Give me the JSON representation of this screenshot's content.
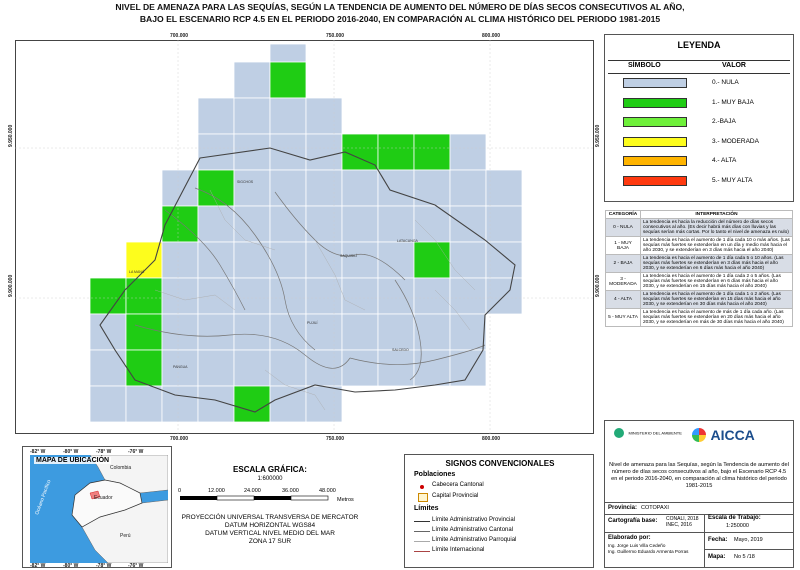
{
  "title": {
    "line1": "NIVEL DE AMENAZA PARA LAS SEQUÍAS, SEGÚN LA TENDENCIA DE AUMENTO DEL NÚMERO DE DÍAS SECOS CONSECUTIVOS AL AÑO,",
    "line2": "BAJO EL ESCENARIO RCP 4.5 EN EL PERIODO 2016-2040, EN COMPARACIÓN AL CLIMA HISTÓRICO DEL PERIODO 1981-2015"
  },
  "map": {
    "x_ticks_top": [
      "700.000",
      "750.000",
      "800.000"
    ],
    "x_ticks_bottom": [
      "700.000",
      "750.000",
      "800.000"
    ],
    "y_ticks_left": [
      "9.950.000",
      "9.900.000"
    ],
    "y_ticks_right": [
      "9.950.000",
      "9.900.000"
    ],
    "place_labels": [
      "SIGCHOS",
      "SAQUISILÍ",
      "LATACUNGA",
      "PUJILÍ",
      "SALCEDO",
      "PANGUA",
      "LA MANÁ",
      "PUJILÍ"
    ],
    "colors": {
      "nula": "#bfcfe4",
      "muy_baja": "#1fcc14",
      "baja": "#6ef03a",
      "moderada": "#fdfd1d",
      "alta": "#ffb400",
      "muy_alta": "#ff3a10"
    }
  },
  "legend": {
    "title": "LEYENDA",
    "col_symbol": "SÍMBOLO",
    "col_value": "VALOR",
    "items": [
      {
        "label": "0.- NULA",
        "color": "#bfcfe4"
      },
      {
        "label": "1.- MUY BAJA",
        "color": "#1fcc14"
      },
      {
        "label": "2.-BAJA",
        "color": "#6ef03a"
      },
      {
        "label": "3.- MODERADA",
        "color": "#fdfd1d"
      },
      {
        "label": "4.- ALTA",
        "color": "#ffb400"
      },
      {
        "label": "5.- MUY ALTA",
        "color": "#ff3a10"
      }
    ]
  },
  "interpretation": {
    "col_cat": "CATEGORÍA",
    "col_interp": "INTERPRETACIÓN",
    "rows": [
      {
        "cat": "0 - NULA",
        "text": "La tendencia es hacia la reducción del número de días secos consecutivos al año. (Es decir habrá más días con lluvias y las sequías serían más cortas. Por lo tanto el nivel de amenaza es nulo)"
      },
      {
        "cat": "1 - MUY BAJA",
        "text": "La tendencia es hacia el aumento de 1 día cada 10 o más años. (Las sequías más fuertes se extenderían en un día y medio más hacia el año 2030, y se extenderían en 3 días más hacia el año 2040)"
      },
      {
        "cat": "2 - BAJA",
        "text": "La tendencia es hacia el aumento de 1 día cada 5 o 10 años. (Las sequías más fuertes se extenderían en 3 días más hacia el año 2030, y se extenderían en 6 días más hacia el año 2040)"
      },
      {
        "cat": "3 - MODERADA",
        "text": "La tendencia es hacia el aumento de 1 día cada 2 o 5 años. (Las sequías más fuertes se extenderían en 6 días más hacia el año 2030, y se extenderían en 15 días más hacia el año 2040)"
      },
      {
        "cat": "4 - ALTA",
        "text": "La tendencia es hacia el aumento de 1 día cada 1 o 2 años. (Las sequías más fuertes se extenderían en 15 días más hacia el año 2030, y se extenderían en 30 días más hacia el año 2040)"
      },
      {
        "cat": "5 - MUY ALTA",
        "text": "La tendencia es hacia el aumento de más de 1 día cada año. (Las sequías más fuertes se extenderían en 20 días más hacia el año 2030, y se extenderían en más de 30 días más hacia el año 2040)"
      }
    ]
  },
  "location_map": {
    "title": "MAPA DE UBICACIÓN",
    "labels": {
      "colombia": "Colombia",
      "ecuador": "Ecuador",
      "peru": "Perú",
      "ocean": "Océano Pacífico"
    },
    "lon_ticks": [
      "-82° W",
      "-80° W",
      "-78° W",
      "-76° W"
    ]
  },
  "scale": {
    "title": "ESCALA GRÁFICA:",
    "ratio": "1:600000",
    "ticks": [
      "0",
      "12.000",
      "24.000",
      "36.000",
      "48.000"
    ],
    "unit": "Metros",
    "projection": [
      "PROYECCIÓN UNIVERSAL TRANSVERSA DE MERCATOR",
      "DATUM HORIZONTAL WGS84",
      "DATUM VERTICAL NIVEL MEDIO DEL MAR",
      "ZONA 17 SUR"
    ]
  },
  "signs": {
    "title": "SIGNOS CONVENCIONALES",
    "poblaciones": "Poblaciones",
    "cabecera_cantonal": "Cabecera Cantonal",
    "capital_provincial": "Capital Provincial",
    "limites": "Límites",
    "lim_provincial": "Límite Administrativo Provincial",
    "lim_cantonal": "Límite Administrativo Cantonal",
    "lim_parroquial": "Límite Administrativo Parroquial",
    "lim_internacional": "Límite Internacional"
  },
  "info": {
    "logo_ministry": "MINISTERIO DEL AMBIENTE",
    "logo_aicca": "AICCA",
    "description": "Nivel de amenaza para las Sequías, según la Tendencia de aumento del número de días secos consecutivos al año, bajo el Escenario RCP 4.5 en el periodo 2016-2040, en comparación al clima histórico del periodo 1981-2015",
    "provincia_label": "Provincia:",
    "provincia": "COTOPAXI",
    "cartografia_label": "Cartografía base:",
    "cartografia": "CONALI, 2018\nINEC, 2016",
    "escala_label": "Escala de Trabajo:",
    "escala": "1:250000",
    "elaborado_label": "Elaborado por:",
    "elaborado": "Ing. Jorge Luis Villa Cedeño\nIng. Guillermo Eduardo Armenta Porras",
    "fecha_label": "Fecha:",
    "fecha": "Mayo, 2019",
    "mapa_label": "Mapa:",
    "mapa": "No 5 /18"
  }
}
